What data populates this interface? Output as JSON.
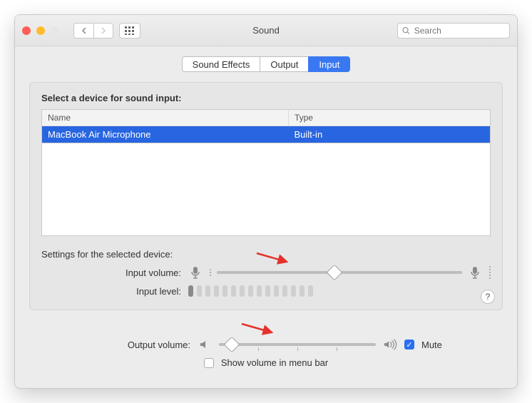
{
  "window": {
    "title": "Sound"
  },
  "search": {
    "placeholder": "Search"
  },
  "tabs": {
    "sound_effects": "Sound Effects",
    "output": "Output",
    "input": "Input"
  },
  "input_panel": {
    "heading": "Select a device for sound input:",
    "columns": {
      "name": "Name",
      "type": "Type"
    },
    "devices": [
      {
        "name": "MacBook Air Microphone",
        "type": "Built-in",
        "selected": true
      }
    ],
    "settings_heading": "Settings for the selected device:",
    "input_volume_label": "Input volume:",
    "input_volume_percent": 48,
    "input_level_label": "Input level:",
    "input_level_active_bars": 1,
    "input_level_total_bars": 15
  },
  "footer": {
    "output_volume_label": "Output volume:",
    "output_volume_percent": 8,
    "mute_label": "Mute",
    "mute_checked": true,
    "menu_bar_label": "Show volume in menu bar",
    "menu_bar_checked": false
  }
}
